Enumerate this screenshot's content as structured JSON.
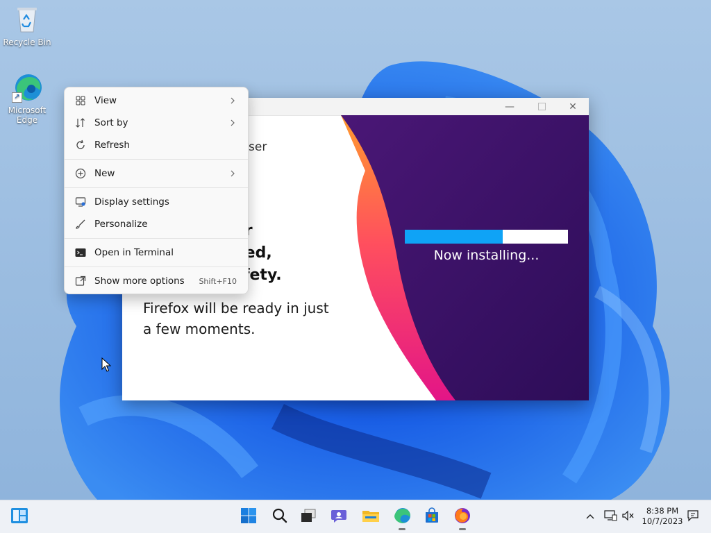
{
  "desktop": {
    "icons": [
      {
        "label": "Recycle Bin"
      },
      {
        "label": "Microsoft Edge"
      }
    ]
  },
  "installer": {
    "brand_fragment": "ser",
    "headline": [
      "our",
      "peed,",
      "safety."
    ],
    "ready_text": "Firefox will be ready in just a few moments.",
    "progress_fraction": 0.6,
    "status": "Now installing...",
    "colors": {
      "progress": "#0fa3f6",
      "panel": "#3b1266"
    }
  },
  "context_menu": {
    "items": [
      {
        "label": "View",
        "icon": "grid-view-icon",
        "submenu": true
      },
      {
        "label": "Sort by",
        "icon": "sort-icon",
        "submenu": true
      },
      {
        "label": "Refresh",
        "icon": "refresh-icon",
        "submenu": false
      },
      {
        "label": "New",
        "icon": "new-plus-icon",
        "submenu": true
      },
      {
        "label": "Display settings",
        "icon": "display-settings-icon",
        "submenu": false
      },
      {
        "label": "Personalize",
        "icon": "personalize-brush-icon",
        "submenu": false
      },
      {
        "label": "Open in Terminal",
        "icon": "terminal-icon",
        "submenu": false
      },
      {
        "label": "Show more options",
        "icon": "show-more-icon",
        "shortcut": "Shift+F10",
        "submenu": false
      }
    ]
  },
  "taskbar": {
    "pinned": [
      "start-icon",
      "search-icon",
      "task-view-icon",
      "chat-icon",
      "file-explorer-icon",
      "edge-icon",
      "store-icon",
      "firefox-icon"
    ],
    "clock": {
      "time": "8:38 PM",
      "date": "10/7/2023"
    }
  }
}
